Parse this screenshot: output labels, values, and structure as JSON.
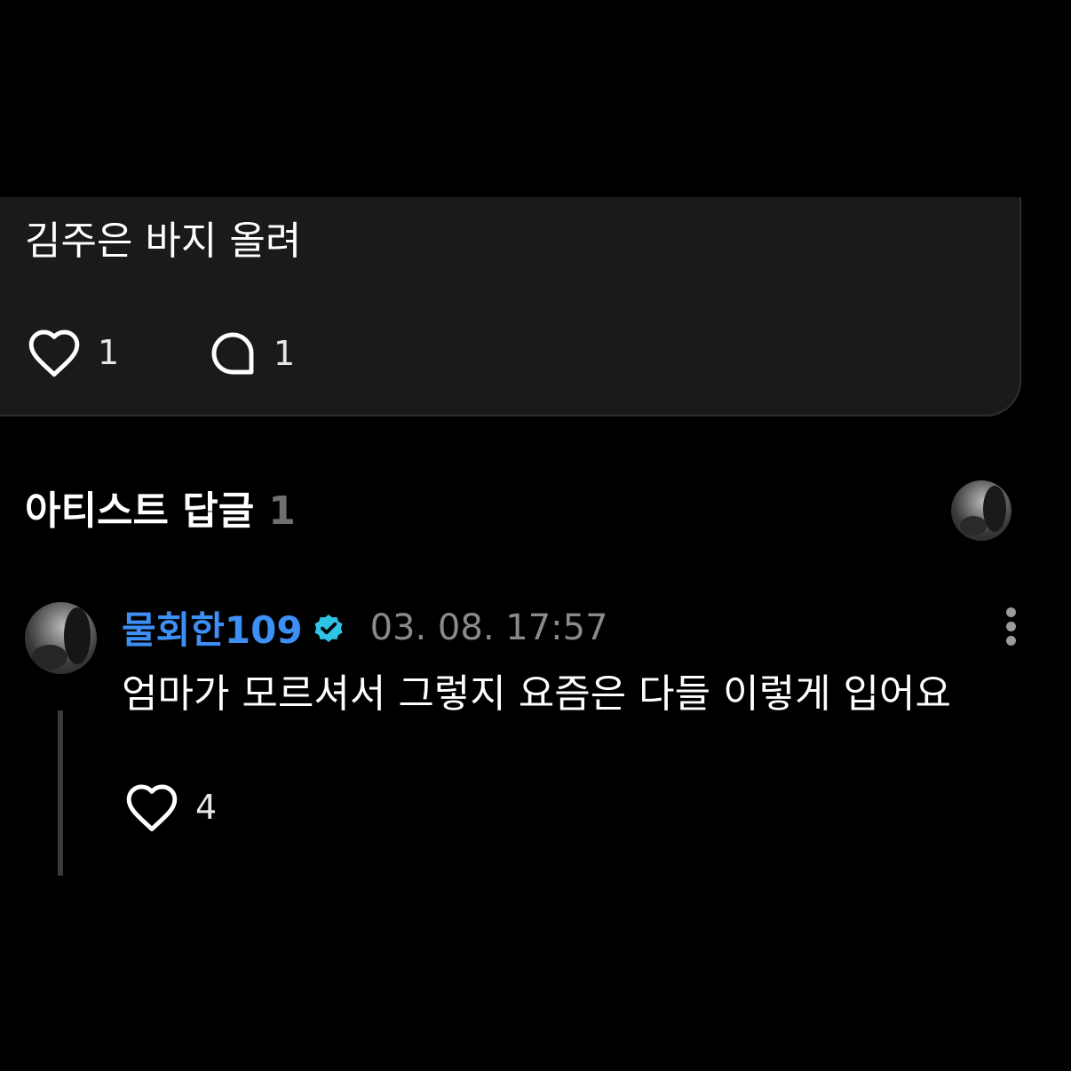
{
  "post": {
    "text": "김주은 바지 올려",
    "like_count": "1",
    "comment_count": "1",
    "like_icon": "heart-outline-icon",
    "comment_icon": "speech-bubble-icon"
  },
  "section": {
    "title": "아티스트 답글",
    "count": "1"
  },
  "reply": {
    "username": "물회한109",
    "verified_icon": "verified-badge-icon",
    "timestamp": "03. 08. 17:57",
    "text": "엄마가 모르셔서 그렇지 요즘은 다들 이렇게 입어요",
    "like_count": "4",
    "more_icon": "more-vertical-icon"
  },
  "colors": {
    "background": "#000000",
    "card": "#1a1a1a",
    "username": "#3d8ff5",
    "verified": "#2ec4e6",
    "timestamp": "#8a8a8a",
    "section_count": "#6f6f6f"
  }
}
